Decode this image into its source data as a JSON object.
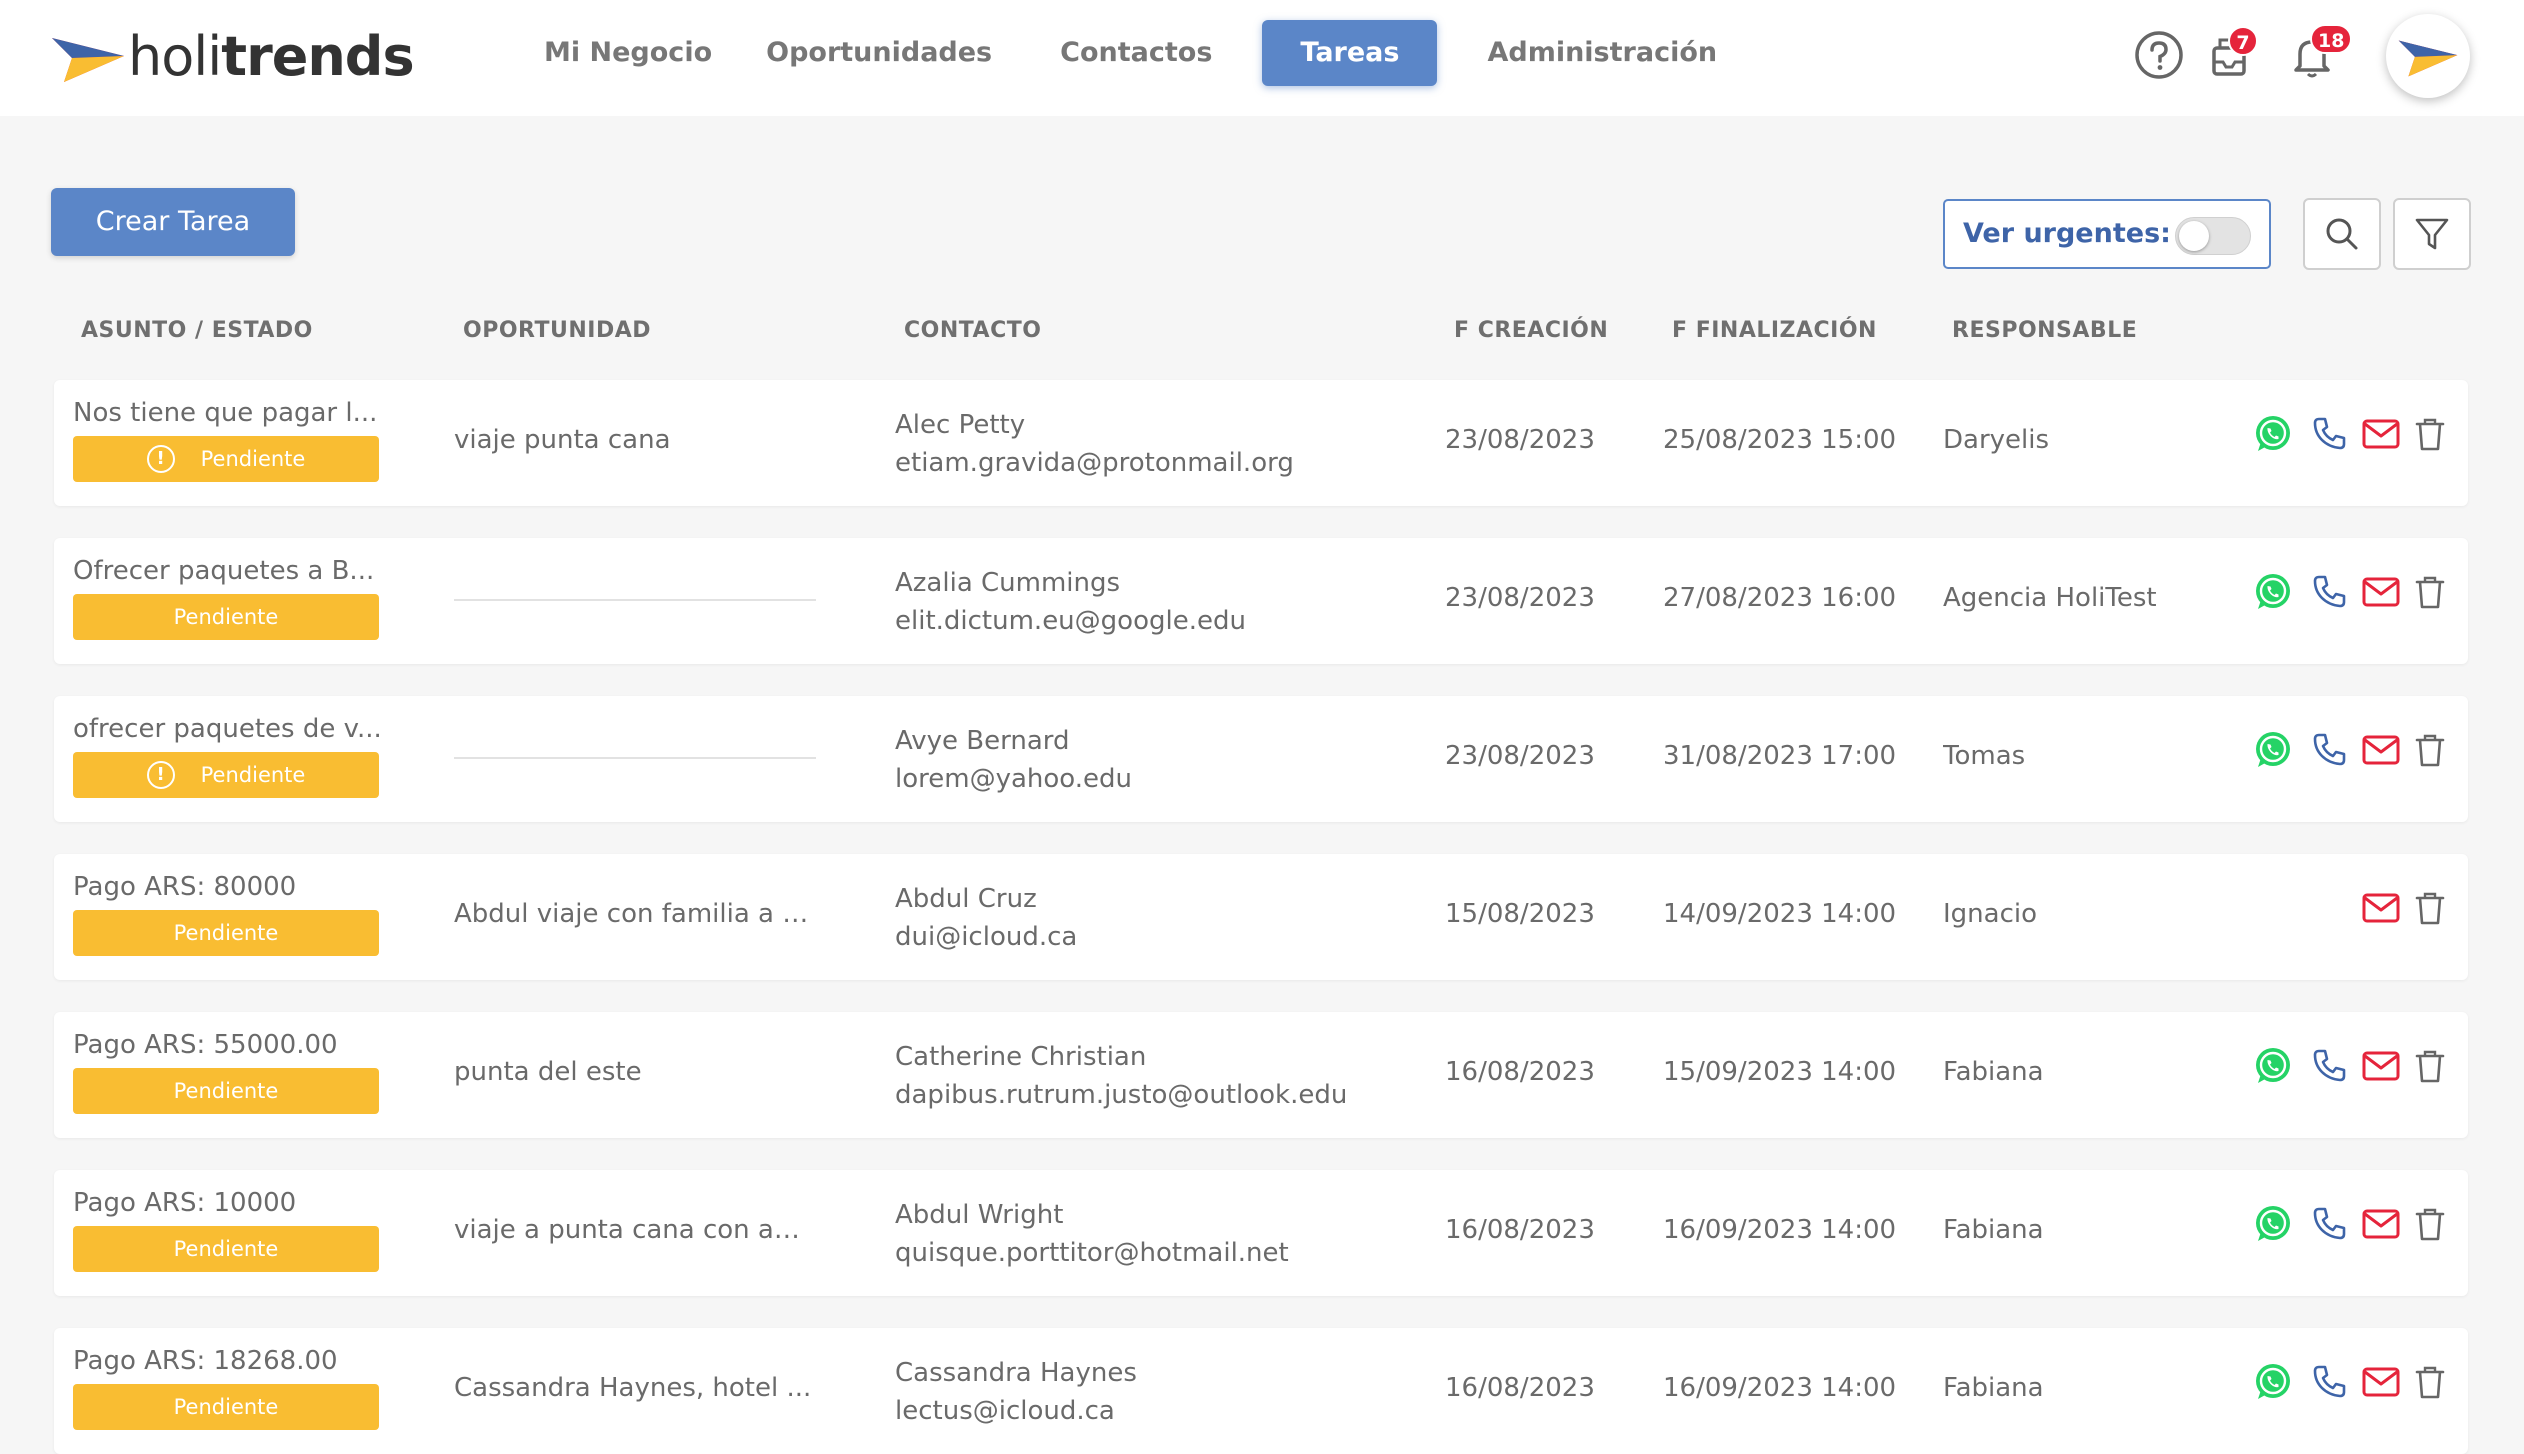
{
  "app": {
    "logo_text_light": "holi",
    "logo_text_bold": "trends"
  },
  "nav": {
    "items": [
      {
        "label": "Mi Negocio"
      },
      {
        "label": "Oportunidades"
      },
      {
        "label": "Contactos"
      },
      {
        "label": "Tareas",
        "active": true
      },
      {
        "label": "Administración"
      }
    ]
  },
  "header_icons": {
    "help_icon": "help-circle-icon",
    "inbox_icon": "inbox-icon",
    "inbox_badge": "7",
    "bell_icon": "bell-icon",
    "bell_badge": "18"
  },
  "toolbar": {
    "create_label": "Crear Tarea",
    "urgent_label": "Ver urgentes:",
    "urgent_enabled": false,
    "search_icon": "search-icon",
    "filter_icon": "filter-icon"
  },
  "table": {
    "columns": [
      "ASUNTO / ESTADO",
      "OPORTUNIDAD",
      "CONTACTO",
      "F CREACIÓN",
      "F FINALIZACIÓN",
      "RESPONSABLE"
    ],
    "rows": [
      {
        "subject": "Nos tiene que pagar l...",
        "status": "Pendiente",
        "warning": true,
        "opportunity": "viaje punta cana",
        "contact_name": "Alec Petty",
        "contact_email": "etiam.gravida@protonmail.org",
        "created": "23/08/2023",
        "due": "25/08/2023 15:00",
        "owner": "Daryelis",
        "whatsapp": true,
        "phone": true
      },
      {
        "subject": "Ofrecer paquetes a B...",
        "status": "Pendiente",
        "warning": false,
        "opportunity": "",
        "contact_name": "Azalia Cummings",
        "contact_email": "elit.dictum.eu@google.edu",
        "created": "23/08/2023",
        "due": "27/08/2023 16:00",
        "owner": "Agencia HoliTest",
        "whatsapp": true,
        "phone": true
      },
      {
        "subject": "ofrecer paquetes de v...",
        "status": "Pendiente",
        "warning": true,
        "opportunity": "",
        "contact_name": "Avye Bernard",
        "contact_email": "lorem@yahoo.edu",
        "created": "23/08/2023",
        "due": "31/08/2023 17:00",
        "owner": "Tomas",
        "whatsapp": true,
        "phone": true
      },
      {
        "subject": "Pago ARS: 80000",
        "status": "Pendiente",
        "warning": false,
        "opportunity": "Abdul viaje con familia a S...",
        "contact_name": "Abdul Cruz",
        "contact_email": "dui@icloud.ca",
        "created": "15/08/2023",
        "due": "14/09/2023 14:00",
        "owner": "Ignacio",
        "whatsapp": false,
        "phone": false
      },
      {
        "subject": "Pago ARS: 55000.00",
        "status": "Pendiente",
        "warning": false,
        "opportunity": "punta del este",
        "contact_name": "Catherine Christian",
        "contact_email": "dapibus.rutrum.justo@outlook.edu",
        "created": "16/08/2023",
        "due": "15/09/2023 14:00",
        "owner": "Fabiana",
        "whatsapp": true,
        "phone": true
      },
      {
        "subject": "Pago ARS: 10000",
        "status": "Pendiente",
        "warning": false,
        "opportunity": "viaje a punta cana con am...",
        "contact_name": "Abdul Wright",
        "contact_email": "quisque.porttitor@hotmail.net",
        "created": "16/08/2023",
        "due": "16/09/2023 14:00",
        "owner": "Fabiana",
        "whatsapp": true,
        "phone": true
      },
      {
        "subject": "Pago ARS: 18268.00",
        "status": "Pendiente",
        "warning": false,
        "opportunity": "Cassandra Haynes, hotel ...",
        "contact_name": "Cassandra Haynes",
        "contact_email": "lectus@icloud.ca",
        "created": "16/08/2023",
        "due": "16/09/2023 14:00",
        "owner": "Fabiana",
        "whatsapp": true,
        "phone": true
      }
    ]
  },
  "colors": {
    "accent": "#5b86c8",
    "status_pending": "#f9bd32",
    "badge": "#e5243b",
    "whatsapp": "#25d366",
    "phone": "#3e64a8",
    "mail": "#e5243b"
  }
}
